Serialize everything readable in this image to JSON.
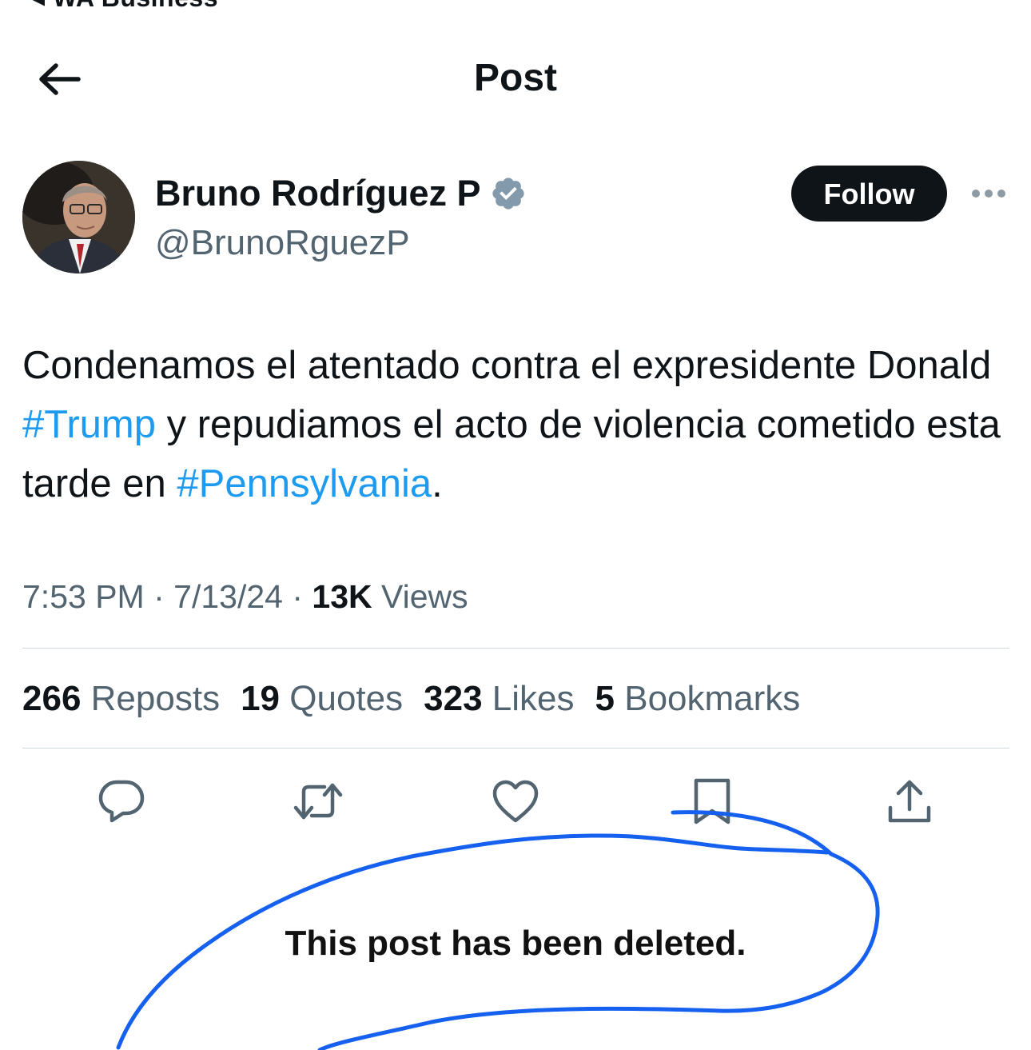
{
  "status_bar": {
    "back_app_label": "◂ WA Business"
  },
  "header": {
    "title": "Post"
  },
  "author": {
    "display_name": "Bruno Rodríguez P",
    "handle": "@BrunoRguezP",
    "verified": true,
    "follow_label": "Follow"
  },
  "post": {
    "text_parts": [
      "Condenamos el atentado contra el expresidente Donald ",
      "#Trump",
      " y repudiamos el acto de violencia cometido esta tarde en ",
      "#Pennsylvania",
      "."
    ],
    "time": "7:53 PM",
    "date": "7/13/24",
    "views_count": "13K",
    "views_label": "Views"
  },
  "stats": {
    "reposts_count": "266",
    "reposts_label": "Reposts",
    "quotes_count": "19",
    "quotes_label": "Quotes",
    "likes_count": "323",
    "likes_label": "Likes",
    "bookmarks_count": "5",
    "bookmarks_label": "Bookmarks"
  },
  "annotation": {
    "text": "This post has been deleted.",
    "ink_color": "#1660f0"
  },
  "colors": {
    "text_primary": "#0f1419",
    "text_secondary": "#536471",
    "hashtag": "#1d9bf0",
    "divider": "#cfd9de",
    "verified_badge": "#829aab"
  }
}
